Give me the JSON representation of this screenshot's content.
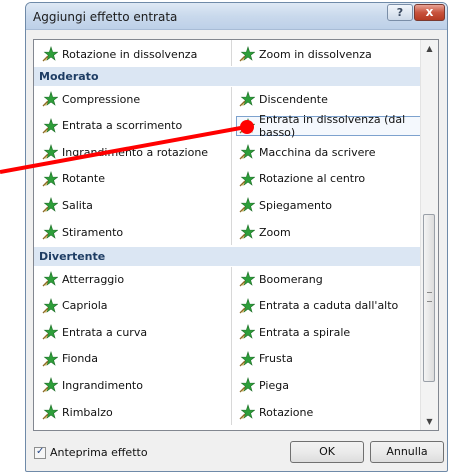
{
  "dialog": {
    "title": "Aggiungi effetto entrata",
    "help_label": "?",
    "close_label": "x"
  },
  "list": {
    "top_row": {
      "left": "Rotazione in dissolvenza",
      "right": "Zoom in dissolvenza"
    },
    "sections": [
      {
        "name": "Moderato",
        "rows": [
          {
            "left": "Compressione",
            "right": "Discendente"
          },
          {
            "left": "Entrata a scorrimento",
            "right": "Entrata in dissolvenza (dal basso)"
          },
          {
            "left": "Ingrandimento a rotazione",
            "right": "Macchina da scrivere"
          },
          {
            "left": "Rotante",
            "right": "Rotazione al centro"
          },
          {
            "left": "Salita",
            "right": "Spiegamento"
          },
          {
            "left": "Stiramento",
            "right": "Zoom"
          }
        ]
      },
      {
        "name": "Divertente",
        "rows": [
          {
            "left": "Atterraggio",
            "right": "Boomerang"
          },
          {
            "left": "Capriola",
            "right": "Entrata a caduta dall'alto"
          },
          {
            "left": "Entrata a curva",
            "right": "Entrata a spirale"
          },
          {
            "left": "Fionda",
            "right": "Frusta"
          },
          {
            "left": "Ingrandimento",
            "right": "Piega"
          },
          {
            "left": "Rimbalzo",
            "right": "Rotazione"
          }
        ]
      }
    ],
    "selected": "Entrata in dissolvenza (dal basso)"
  },
  "footer": {
    "preview_label": "Anteprima effetto",
    "preview_checked": true,
    "ok_label": "OK",
    "cancel_label": "Annulla"
  },
  "colors": {
    "section_bg": "#dbe6f3",
    "section_text": "#1e3d64",
    "star_green": "#2e9e3a",
    "annotation_red": "#ff0000"
  }
}
